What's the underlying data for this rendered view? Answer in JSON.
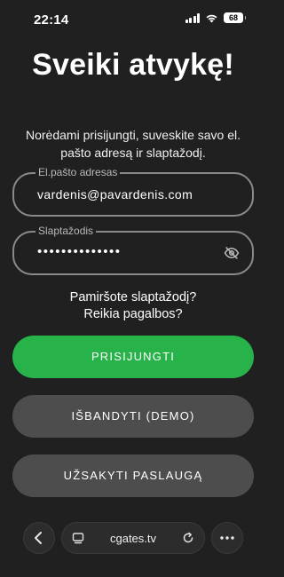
{
  "status_bar": {
    "time": "22:14",
    "battery": "68",
    "icons": [
      "signal-icon",
      "wifi-icon",
      "battery-icon"
    ]
  },
  "login": {
    "title": "Sveiki atvykę!",
    "subtitle": "Norėdami prisijungti, suveskite savo el. pašto adresą ir slaptažodį.",
    "email_label": "El.pašto adresas",
    "email_value": "vardenis@pavardenis.com",
    "password_label": "Slaptažodis",
    "password_value": "••••••••••••••",
    "forgot_password": "Pamiršote slaptažodį?",
    "need_help": "Reikia pagalbos?",
    "login_button": "PRISIJUNGTI",
    "demo_button": "IŠBANDYTI (DEMO)",
    "order_button": "UŽSAKYTI PASLAUGĄ"
  },
  "browser": {
    "url": "cgates.tv"
  },
  "colors": {
    "background": "#202020",
    "primary": "#27b34a",
    "secondary_button": "#4d4d4d",
    "field_border": "#8a8a8a"
  }
}
